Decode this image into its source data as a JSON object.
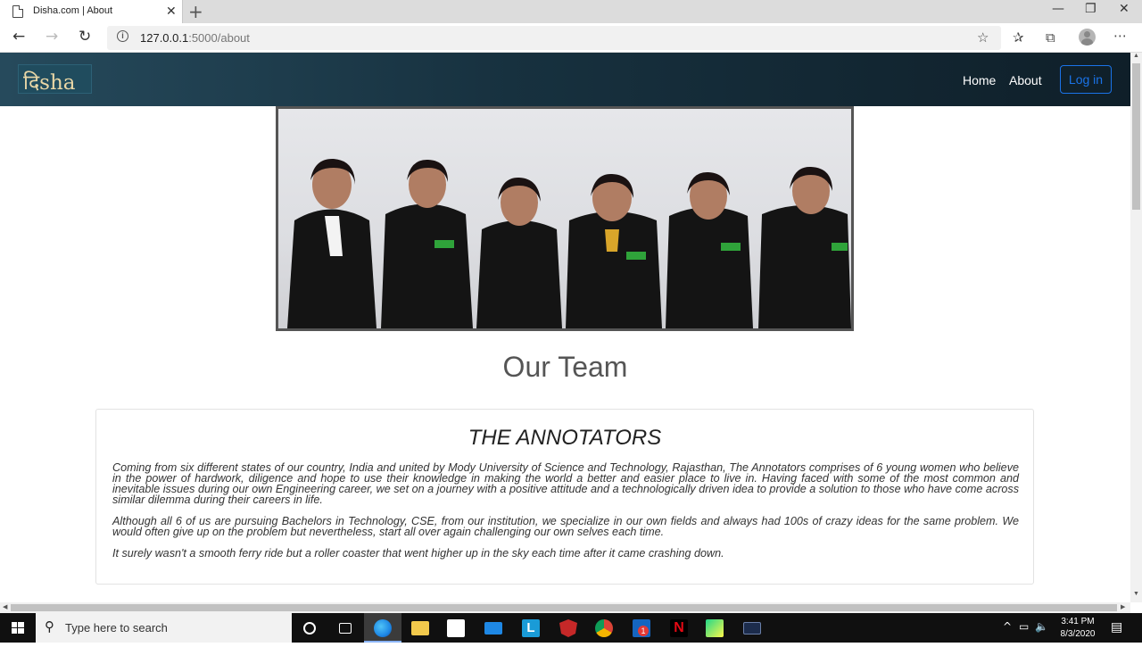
{
  "browser": {
    "tab_title": "Disha.com | About",
    "tab_close": "✕",
    "new_tab": "+",
    "url_host": "127.0.0.1",
    "url_path": ":5000/about",
    "minimize": "—",
    "maximize": "❐",
    "close": "✕"
  },
  "site": {
    "logo_text": "दिsha",
    "nav": {
      "home": "Home",
      "about": "About",
      "login": "Log in"
    }
  },
  "main": {
    "heading": "Our Team",
    "card": {
      "title": "THE ANNOTATORS",
      "paragraphs": [
        "Coming from six different states of our country, India and united by Mody University of Science and Technology, Rajasthan, The Annotators comprises of 6 young women who believe in the power of hardwork, diligence and hope to use their knowledge in making the world a better and easier place to live in. Having faced with some of the most common and inevitable issues during our own Engineering career, we set on a journey with a positive attitude and a technologically driven idea to provide a solution to those who have come across similar dilemma during their careers in life.",
        "Although all 6 of us are pursuing Bachelors in Technology, CSE, from our institution, we specialize in our own fields and always had 100s of crazy ideas for the same problem. We would often give up on the problem but nevertheless, start all over again challenging our own selves each time.",
        "It surely wasn't a smooth ferry ride but a roller coaster that went higher up in the sky each time after it came crashing down."
      ]
    }
  },
  "taskbar": {
    "search_placeholder": "Type here to search",
    "time": "3:41 PM",
    "date": "8/3/2020",
    "badge": "1"
  },
  "colors": {
    "navbar_dark": "#0f1f29",
    "navbar_light": "#264a5c",
    "login_accent": "#1a73e8"
  }
}
